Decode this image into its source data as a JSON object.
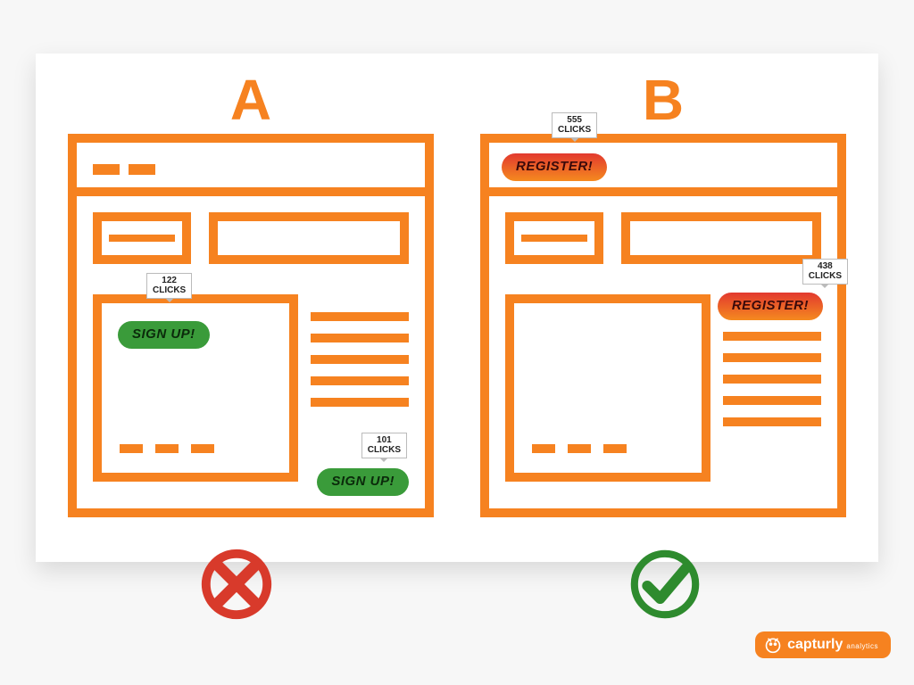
{
  "variants": {
    "a": {
      "label": "A",
      "cta1": {
        "text": "SIGN UP!",
        "clicks_num": "122",
        "clicks_word": "CLICKS"
      },
      "cta2": {
        "text": "SIGN UP!",
        "clicks_num": "101",
        "clicks_word": "CLICKS"
      },
      "result": "fail"
    },
    "b": {
      "label": "B",
      "cta1": {
        "text": "REGISTER!",
        "clicks_num": "555",
        "clicks_word": "CLICKS"
      },
      "cta2": {
        "text": "REGISTER!",
        "clicks_num": "438",
        "clicks_word": "CLICKS"
      },
      "result": "pass"
    }
  },
  "brand": {
    "name": "capturly",
    "tagline": "analytics"
  },
  "colors": {
    "orange": "#f68220",
    "fail": "#d83a2b",
    "pass": "#2e8b2e",
    "cta_green": "#3a9b3a",
    "cta_red_gradient": [
      "#e2392f",
      "#f58a1f"
    ],
    "cta_shadow": "#f4c430"
  }
}
